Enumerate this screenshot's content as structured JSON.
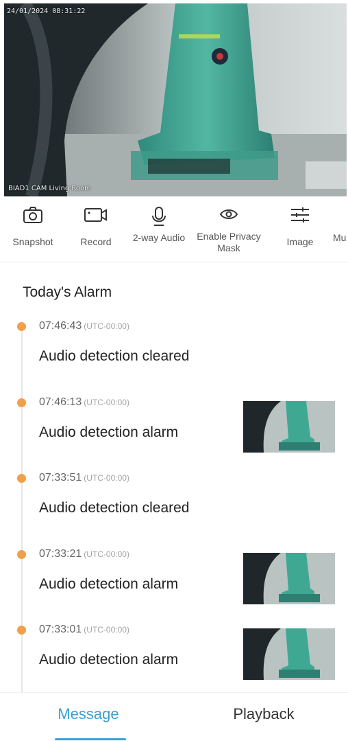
{
  "feed": {
    "timestamp": "24/01/2024 08:31:22",
    "camera_label": "BIAD1 CAM Living Room"
  },
  "toolbar": {
    "items": [
      {
        "label": "Snapshot",
        "icon": "camera-icon"
      },
      {
        "label": "Record",
        "icon": "video-icon"
      },
      {
        "label": "2-way Audio",
        "icon": "microphone-icon"
      },
      {
        "label": "Enable Privacy Mask",
        "icon": "eye-icon"
      },
      {
        "label": "Image",
        "icon": "sliders-icon"
      },
      {
        "label": "Mu",
        "icon": "more-icon"
      }
    ]
  },
  "alarms": {
    "title": "Today's Alarm",
    "items": [
      {
        "time": "07:46:43",
        "timezone": "(UTC-00:00)",
        "text": "Audio detection cleared",
        "has_thumbnail": false
      },
      {
        "time": "07:46:13",
        "timezone": "(UTC-00:00)",
        "text": "Audio detection alarm",
        "has_thumbnail": true
      },
      {
        "time": "07:33:51",
        "timezone": "(UTC-00:00)",
        "text": "Audio detection cleared",
        "has_thumbnail": false
      },
      {
        "time": "07:33:21",
        "timezone": "(UTC-00:00)",
        "text": "Audio detection alarm",
        "has_thumbnail": true
      },
      {
        "time": "07:33:01",
        "timezone": "(UTC-00:00)",
        "text": "Audio detection alarm",
        "has_thumbnail": true
      }
    ]
  },
  "tabs": {
    "message": "Message",
    "playback": "Playback"
  },
  "colors": {
    "accent": "#3a9fd4",
    "timeline_dot": "#f0a04b"
  }
}
